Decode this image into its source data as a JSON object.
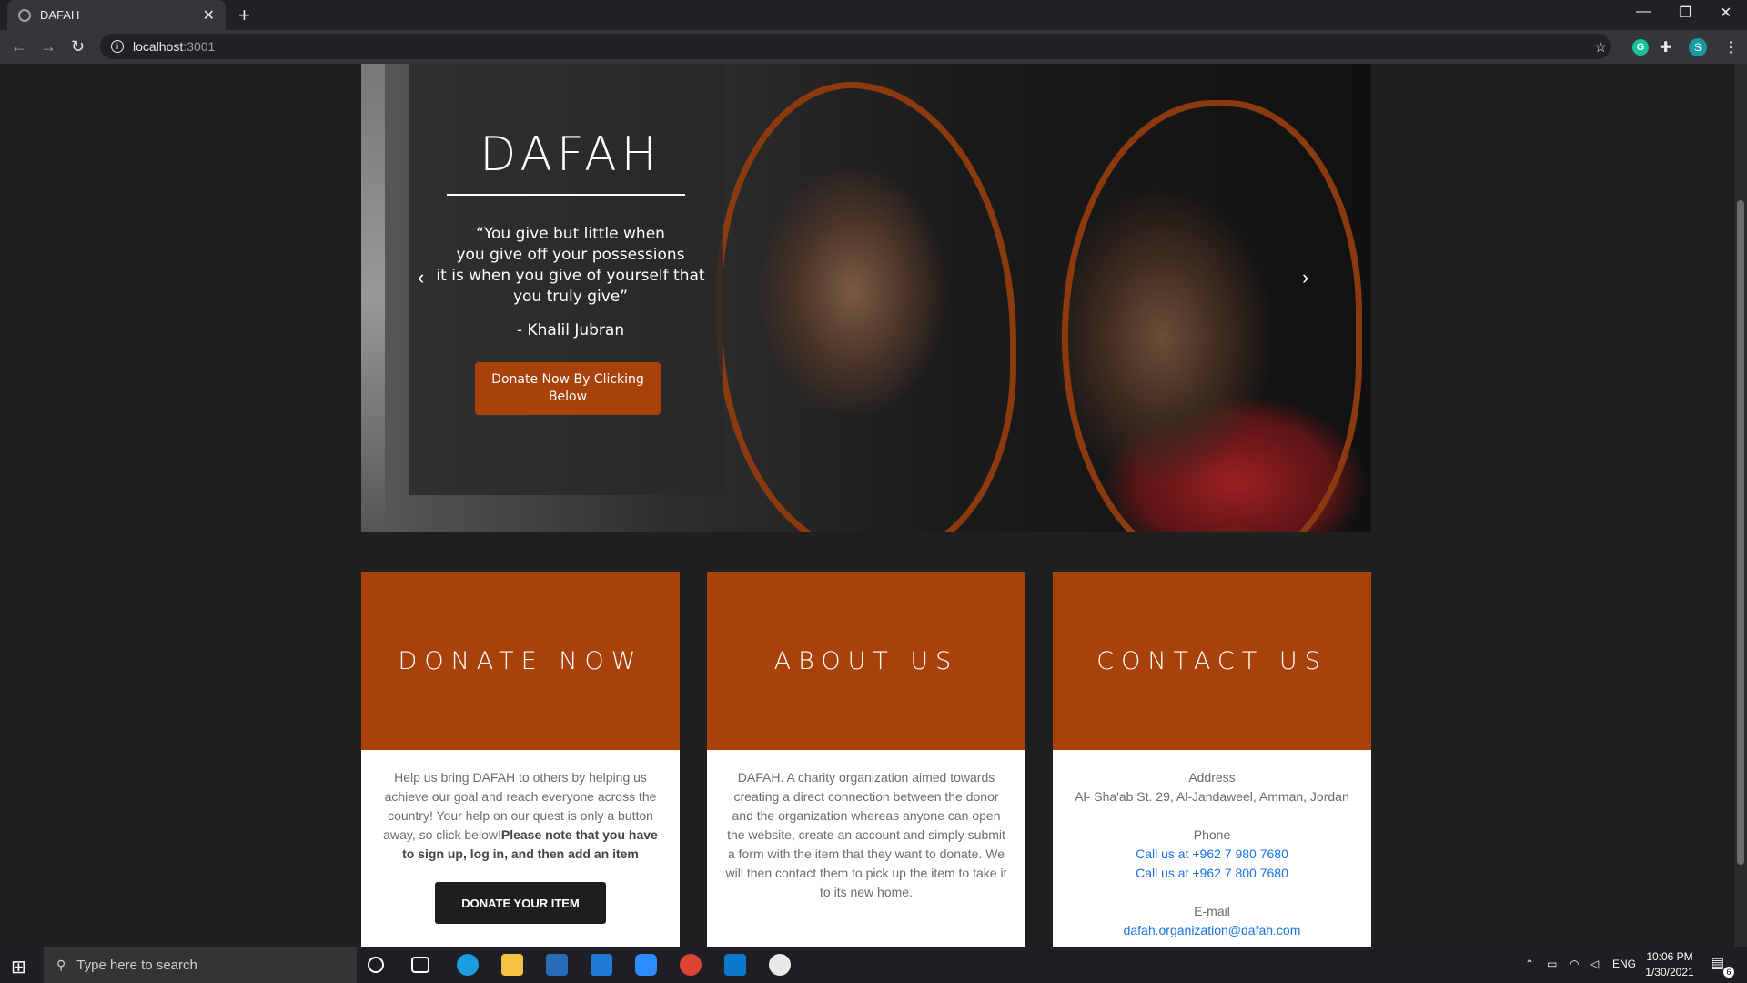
{
  "browser": {
    "tab_title": "DAFAH",
    "url_host": "localhost",
    "url_port": ":3001",
    "profile_initial": "S",
    "extension_initial": "G"
  },
  "hero": {
    "title": "DAFAH",
    "quote_lines": [
      "“You give but little when",
      "you give off your possessions",
      "it is when you give of yourself that",
      "you truly give”"
    ],
    "author": "- Khalil Jubran",
    "cta": "Donate Now By Clicking Below",
    "prev_arrow": "‹",
    "next_arrow": "›"
  },
  "cards": {
    "donate": {
      "heading": "DONATE NOW",
      "text": "Help us bring DAFAH to others by helping us achieve our goal and reach everyone across the country! Your help on our quest is only a button away, so click below!",
      "note": "Please note that you have to sign up, log in, and then add an item",
      "button": "DONATE YOUR ITEM"
    },
    "about": {
      "heading": "ABOUT US",
      "text": "DAFAH. A charity organization aimed towards creating a direct connection between the donor and the organization whereas anyone can open the website, create an account and simply submit a form with the item that they want to donate. We will then contact them to pick up the item to take it to its new home."
    },
    "contact": {
      "heading": "CONTACT US",
      "address_label": "Address",
      "address": "Al- Sha'ab St. 29, Al-Jandaweel, Amman, Jordan",
      "phone_label": "Phone",
      "phone1": "Call us at +962 7 980 7680",
      "phone2": "Call us at +962 7 800 7680",
      "email_label": "E-mail",
      "email": "dafah.organization@dafah.com"
    }
  },
  "taskbar": {
    "search_placeholder": "Type here to search",
    "language": "ENG",
    "time": "10:06 PM",
    "date": "1/30/2021",
    "notification_count": "6"
  },
  "colors": {
    "accent": "#a9410b",
    "background": "#1f1f1f"
  }
}
